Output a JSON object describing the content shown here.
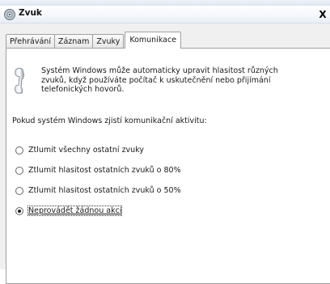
{
  "window": {
    "title": "Zvuk",
    "close_label": "X"
  },
  "tabs": [
    {
      "label": "Přehrávání"
    },
    {
      "label": "Záznam"
    },
    {
      "label": "Zvuky"
    },
    {
      "label": "Komunikace",
      "active": true
    }
  ],
  "intro_lines": [
    "Systém Windows může automaticky upravit hlasitost různých",
    "zvuků, když používáte počítač k uskutečnění nebo přijímání",
    "telefonických hovorů."
  ],
  "prompt": "Pokud systém Windows zjistí komunikační aktivitu:",
  "options": [
    {
      "label": "Ztlumit všechny ostatní zvuky",
      "checked": false
    },
    {
      "label": "Ztlumit hlasitost ostatních zvuků o 80%",
      "checked": false
    },
    {
      "label": "Ztlumit hlasitost ostatních zvuků o 50%",
      "checked": false
    },
    {
      "label": "Neprovádět žádnou akci",
      "checked": true
    }
  ],
  "icons": {
    "app": "speaker-icon",
    "close": "close-icon",
    "phone": "telephone-handset-icon"
  }
}
